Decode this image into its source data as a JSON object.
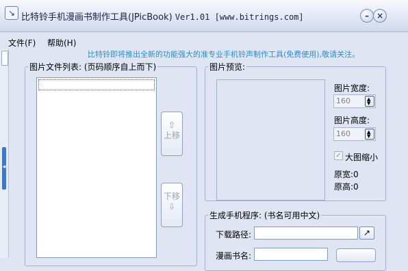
{
  "window": {
    "title_prefix": "比特铃手机漫画书制作工具(JPicBook) ",
    "title_version": "Ver1.01 [www.bitrings.com]",
    "minimize_glyph": "–",
    "close_glyph": "×",
    "app_icon_glyph": "↘"
  },
  "menu": {
    "items": [
      {
        "label": "文件(F)"
      },
      {
        "label": "帮助(H)"
      }
    ]
  },
  "marquee": "比特铃即将推出全新的功能强大的准专业手机铃声制作工具(免费使用),敬请关注。",
  "file_list": {
    "legend": "图片文件列表: (页码顺序自上而下)",
    "items": []
  },
  "move_up": {
    "arrow": "⇧",
    "label": "上移"
  },
  "move_down": {
    "arrow": "⇩",
    "label": "下移"
  },
  "preview": {
    "legend": "图片预览:",
    "width_label": "图片宽度:",
    "width_value": "160",
    "height_label": "图片高度:",
    "height_value": "160",
    "shrink_label": "大图缩小",
    "shrink_checked": true,
    "orig_width": "原宽:0",
    "orig_height": "原高:0"
  },
  "generate": {
    "legend": "生成手机程序: (书名可用中文)",
    "download_path_label": "下载路径:",
    "download_path_value": "",
    "book_name_label": "漫画书名:",
    "book_name_value": ""
  },
  "colors": {
    "marquee": "#2a90c8",
    "background": "#dfe5f2",
    "checkmark": "#79a86a"
  }
}
